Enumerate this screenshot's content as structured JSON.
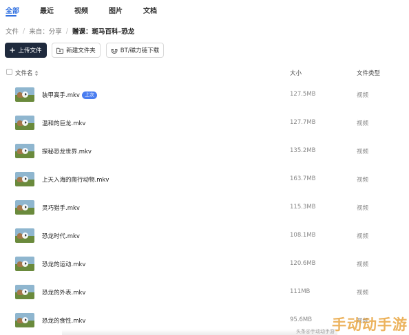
{
  "tabs": [
    {
      "label": "全部",
      "active": true
    },
    {
      "label": "最近",
      "active": false
    },
    {
      "label": "视频",
      "active": false
    },
    {
      "label": "图片",
      "active": false
    },
    {
      "label": "文档",
      "active": false
    }
  ],
  "breadcrumb": {
    "root": "文件",
    "source": "来自：分享",
    "current": "赠课：斑马百科–恐龙"
  },
  "toolbar": {
    "upload_label": "上传文件",
    "new_folder_label": "新建文件夹",
    "bt_label": "BT/磁力链下载"
  },
  "table": {
    "headers": {
      "name": "文件名",
      "size": "大小",
      "type": "文件类型"
    },
    "rows": [
      {
        "name": "装甲高手.mkv",
        "badge": "上次",
        "size": "127.5MB",
        "type": "视频"
      },
      {
        "name": "温和的巨龙.mkv",
        "size": "127.7MB",
        "type": "视频"
      },
      {
        "name": "探秘恐龙世界.mkv",
        "size": "135.2MB",
        "type": "视频"
      },
      {
        "name": "上天入海的爬行动物.mkv",
        "size": "163.7MB",
        "type": "视频"
      },
      {
        "name": "灵巧猎手.mkv",
        "size": "115.3MB",
        "type": "视频"
      },
      {
        "name": "恐龙时代.mkv",
        "size": "108.1MB",
        "type": "视频"
      },
      {
        "name": "恐龙的运动.mkv",
        "size": "120.6MB",
        "type": "视频"
      },
      {
        "name": "恐龙的外表.mkv",
        "size": "111MB",
        "type": "视频"
      },
      {
        "name": "恐龙的食性.mkv",
        "size": "95.6MB",
        "type": "视频"
      }
    ]
  },
  "watermark": {
    "text": "手动动手游",
    "sub": "头条@手动动手游"
  },
  "colors": {
    "accent": "#2f6fe0",
    "primary_button": "#1f2a3d",
    "badge": "#4a7df0",
    "watermark": "#e8a33b"
  }
}
